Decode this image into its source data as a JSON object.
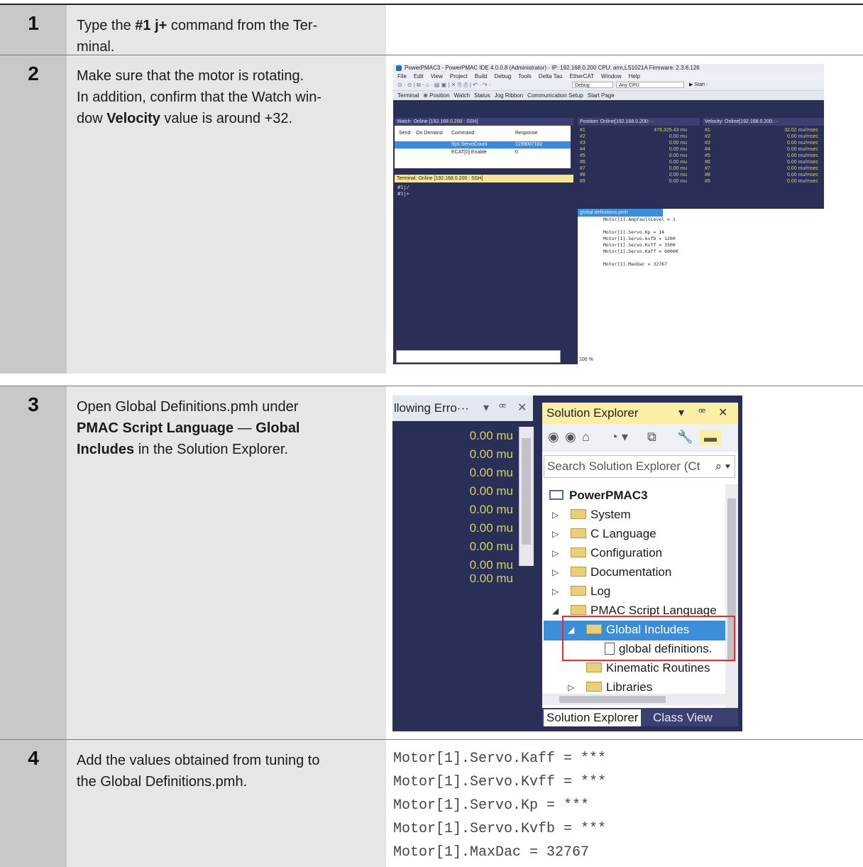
{
  "steps": [
    {
      "number": "1",
      "text_a": "Type the ",
      "bold_a": "#1 j+",
      "text_b": " command from the Ter-",
      "line2": "minal."
    },
    {
      "number": "2",
      "line1": "Make sure that the motor is rotating.",
      "line2": "In addition, confirm that the Watch win-",
      "line3_a": "dow ",
      "bold": "Velocity",
      "line3_b": " value is around +32."
    },
    {
      "number": "3",
      "line1": "Open Global Definitions.pmh under",
      "bold_a": "PMAC Script Language",
      "dash": " — ",
      "bold_b": "Global",
      "bold_c": "Includes",
      "line3_b": " in the Solution Explorer."
    },
    {
      "number": "4",
      "line1": "Add the values obtained from tuning to",
      "line2": "the Global Definitions.pmh."
    }
  ],
  "ide": {
    "title": "PowerPMAC3 - PowerPMAC IDE 4.0.0.8 (Administrator) - IP: 192.168.0.200   CPU: arm,LS1021A   Firmware: 2.3.8.126",
    "menu": [
      "File",
      "Edit",
      "View",
      "Project",
      "Build",
      "Debug",
      "Tools",
      "Delta Tau",
      "EtherCAT",
      "Window",
      "Help"
    ],
    "config": "Debug",
    "platform": "Any CPU",
    "start": "▶ Start -",
    "ribbon": [
      "Terminal",
      "⊕ Position",
      "Watch",
      "Status",
      "Jog Ribbon",
      "Communication Setup",
      "Start Page"
    ],
    "watch_title": "Watch: Online [192.168.0.200 : SSH]",
    "watch_cols": [
      "Send",
      "On Demand",
      "Command",
      "Response"
    ],
    "watch_rows": [
      {
        "command": "Sys.ServoCount",
        "response": "1159007182"
      },
      {
        "command": "ECAT[0].Enable",
        "response": "0"
      }
    ],
    "terminal_title": "Terminal: Online [192.168.0.200 : SSH]",
    "terminal_lines": [
      "#1j/",
      "#1j+"
    ],
    "position_title": "Position: Online[192.168.0.200:···",
    "position_rows": [
      {
        "k": "#1",
        "v": "476,325.43 mu"
      },
      {
        "k": "#2",
        "v": "0.00 mu"
      },
      {
        "k": "#3",
        "v": "0.00 mu"
      },
      {
        "k": "#4",
        "v": "0.00 mu"
      },
      {
        "k": "#5",
        "v": "0.00 mu"
      },
      {
        "k": "#6",
        "v": "0.00 mu"
      },
      {
        "k": "#7",
        "v": "0.00 mu"
      },
      {
        "k": "#8",
        "v": "0.00 mu"
      },
      {
        "k": "#9",
        "v": "0.00 mu"
      }
    ],
    "velocity_title": "Velocity: Online[192.168.0.200:···",
    "velocity_rows": [
      {
        "k": "#1",
        "v": "32.02 mu/msec"
      },
      {
        "k": "#2",
        "v": "0.00 mu/msec"
      },
      {
        "k": "#3",
        "v": "0.00 mu/msec"
      },
      {
        "k": "#4",
        "v": "0.00 mu/msec"
      },
      {
        "k": "#5",
        "v": "0.00 mu/msec"
      },
      {
        "k": "#6",
        "v": "0.00 mu/msec"
      },
      {
        "k": "#7",
        "v": "0.00 mu/msec"
      },
      {
        "k": "#8",
        "v": "0.00 mu/msec"
      },
      {
        "k": "#9",
        "v": "0.00 mu/msec"
      }
    ],
    "editor_tab": "global definitions.pmh",
    "editor_lines": [
      "Motor[1].AmpFaultLevel = 1",
      "",
      "Motor[1].Servo.Kp = 14",
      "Motor[1].Servo.kvfb = 1200",
      "Motor[1].Servo.Kvff = 3500",
      "Motor[1].Servo.Kaff = 60000",
      "",
      "Motor[1].MaxDac = 32767"
    ],
    "zoom": "100 %"
  },
  "sol": {
    "left_title": "llowing Erro···",
    "left_values": [
      "0.00 mu",
      "0.00 mu",
      "0.00 mu",
      "0.00 mu",
      "0.00 mu",
      "0.00 mu",
      "0.00 mu",
      "0.00 mu",
      "0.00 mu"
    ],
    "title": "Solution Explorer",
    "search_placeholder": "Search Solution Explorer (Ct",
    "tree": [
      {
        "label": "PowerPMAC3"
      },
      {
        "label": "System"
      },
      {
        "label": "C Language"
      },
      {
        "label": "Configuration"
      },
      {
        "label": "Documentation"
      },
      {
        "label": "Log"
      },
      {
        "label": "PMAC Script Language"
      },
      {
        "label": "Global Includes"
      },
      {
        "label": "global definitions."
      },
      {
        "label": "Kinematic Routines"
      },
      {
        "label": "Libraries"
      }
    ],
    "tab_active": "Solution Explorer",
    "tab_other": "Class View"
  },
  "code_lines": [
    "Motor[1].Servo.Kaff = ***",
    "Motor[1].Servo.Kvff = ***",
    "Motor[1].Servo.Kp = ***",
    "Motor[1].Servo.Kvfb = ***",
    "Motor[1].MaxDac = 32767"
  ],
  "colors": {
    "number_column": "#c8c8c8",
    "text_column": "#e6e6e6",
    "ide_dark": "#2a2f58",
    "value_yellow": "#d5d15f",
    "selection_blue": "#3d8ed8",
    "highlight_red": "#e03030"
  }
}
